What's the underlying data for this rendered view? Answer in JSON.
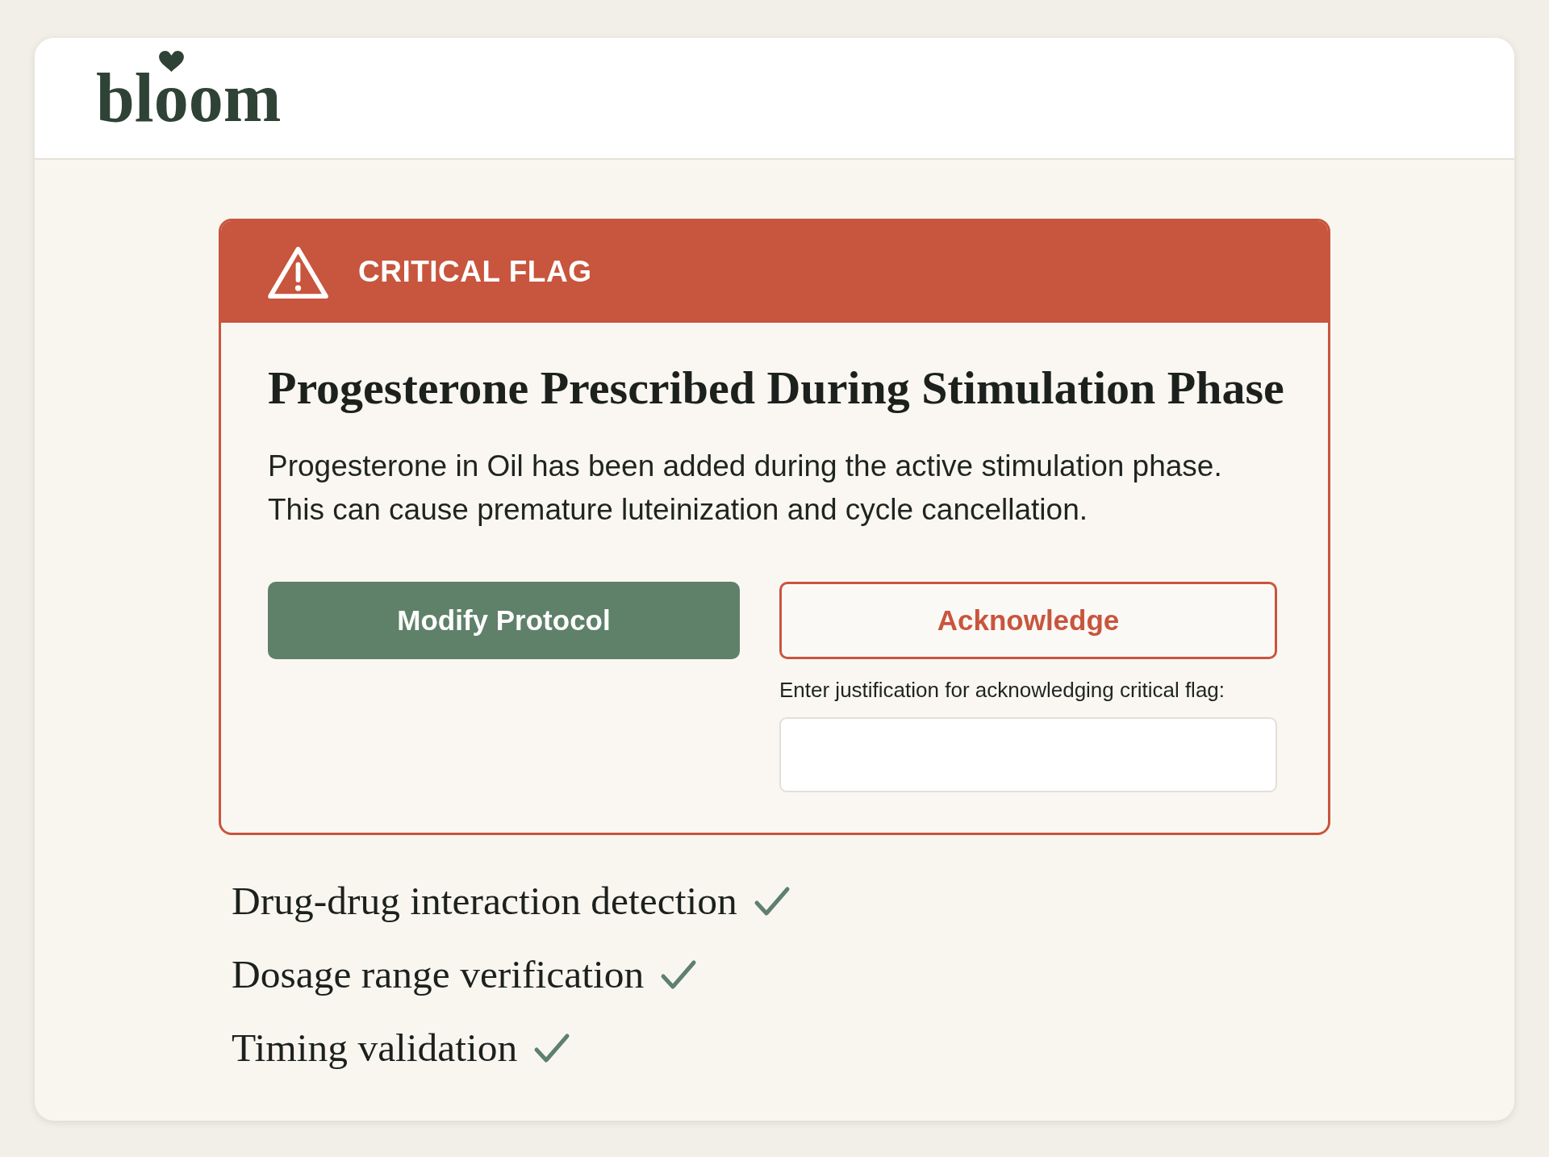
{
  "header": {
    "logo": "bloom"
  },
  "alert": {
    "label": "CRITICAL FLAG",
    "title": "Progesterone Prescribed During Stimulation Phase",
    "message": "Progesterone in Oil has been added during the active stimulation phase.\nThis can cause premature luteinization and cycle cancellation.",
    "actions": [
      {
        "label": "Modify Protocol",
        "kind": "primary"
      },
      {
        "label": "Acknowledge",
        "kind": "outline"
      }
    ],
    "justification": {
      "label": "Enter justification for acknowledging critical flag:"
    }
  },
  "checks": [
    {
      "label": "Drug-drug interaction detection",
      "checked": true
    },
    {
      "label": "Dosage range verification",
      "checked": true
    },
    {
      "label": "Timing validation",
      "checked": true
    }
  ]
}
